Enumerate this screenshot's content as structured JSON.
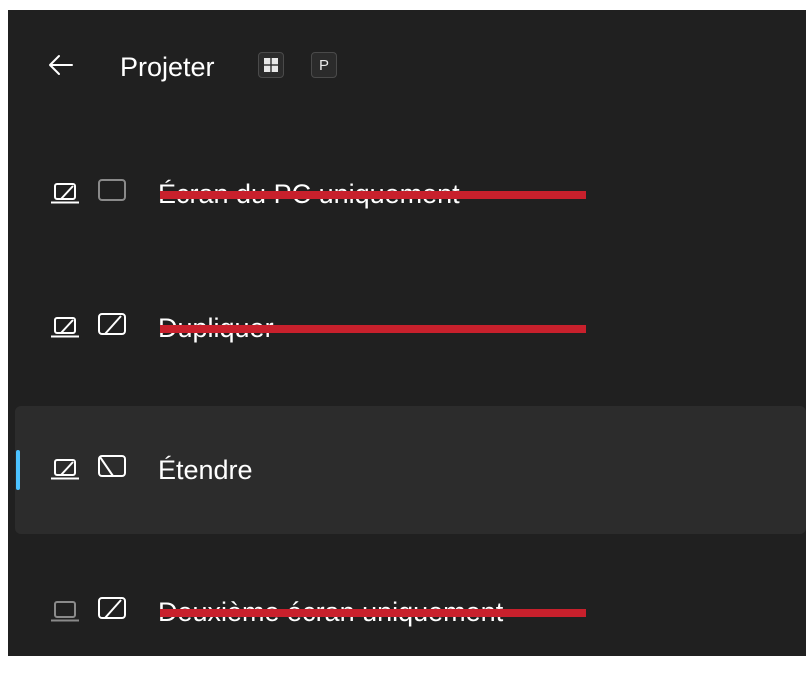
{
  "header": {
    "title": "Projeter",
    "back_icon": "back-arrow-icon",
    "shortcut_keys": [
      "win-key-icon",
      "P"
    ]
  },
  "colors": {
    "panel_background": "#202020",
    "selected_background": "#2c2c2c",
    "accent": "#4cc2ff",
    "redaction": "#c8202c"
  },
  "options": [
    {
      "label": "Écran du PC uniquement",
      "icon": "pc-screen-only-icon",
      "selected": false,
      "redacted": true
    },
    {
      "label": "Dupliquer",
      "icon": "duplicate-icon",
      "selected": false,
      "redacted": true
    },
    {
      "label": "Étendre",
      "icon": "extend-icon",
      "selected": true,
      "redacted": false
    },
    {
      "label": "Deuxième écran uniquement",
      "icon": "second-screen-only-icon",
      "selected": false,
      "redacted": true
    }
  ]
}
